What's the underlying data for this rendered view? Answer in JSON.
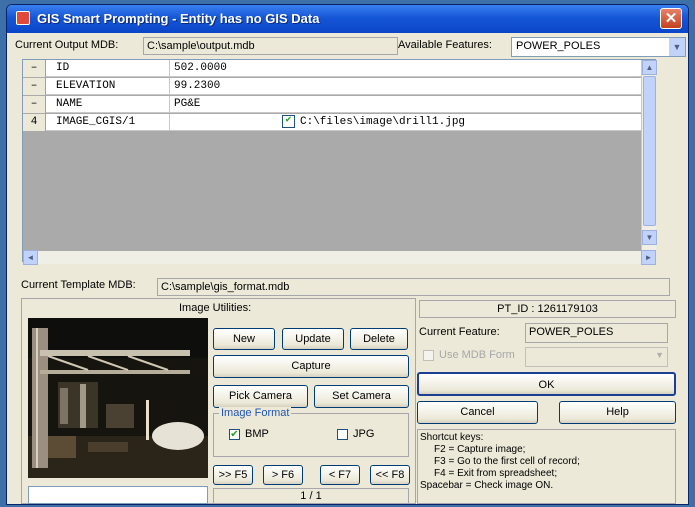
{
  "window": {
    "title": "GIS Smart Prompting - Entity has no GIS Data"
  },
  "header": {
    "output_label": "Current Output MDB:",
    "output_value": "C:\\sample\\output.mdb",
    "features_label": "Available Features:",
    "features_value": "POWER_POLES"
  },
  "grid": {
    "rows": [
      {
        "sel": "–",
        "name": "ID",
        "value": "502.0000"
      },
      {
        "sel": "–",
        "name": "ELEVATION",
        "value": "99.2300"
      },
      {
        "sel": "–",
        "name": "NAME",
        "value": "PG&E"
      },
      {
        "sel": "4",
        "name": "IMAGE_CGIS/1",
        "value": "C:\\files\\image\\drill1.jpg",
        "checked": true
      }
    ]
  },
  "template": {
    "label": "Current Template MDB:",
    "value": "C:\\sample\\gis_format.mdb"
  },
  "image_utilities": {
    "title": "Image Utilities:",
    "new_label": "New",
    "update_label": "Update",
    "delete_label": "Delete",
    "capture_label": "Capture",
    "pick_camera_label": "Pick Camera",
    "set_camera_label": "Set Camera",
    "format_title": "Image Format",
    "bmp_label": "BMP",
    "bmp_checked": true,
    "jpg_label": "JPG",
    "jpg_checked": false,
    "first_label": ">> F5",
    "next_label": "> F6",
    "prev_label": "< F7",
    "last_label": "<< F8",
    "page_indicator": "1 / 1"
  },
  "right_panel": {
    "pt_id": "PT_ID : 1261179103",
    "current_feature_label": "Current Feature:",
    "current_feature_value": "POWER_POLES",
    "use_mdb_label": "Use MDB Form",
    "ok_label": "OK",
    "cancel_label": "Cancel",
    "help_label": "Help"
  },
  "shortcuts": {
    "title": "Shortcut keys:",
    "lines": [
      "F2 = Capture image;",
      "F3 = Go to the first cell of record;",
      "F4 = Exit from spreadsheet;",
      "Spacebar = Check image ON."
    ]
  }
}
